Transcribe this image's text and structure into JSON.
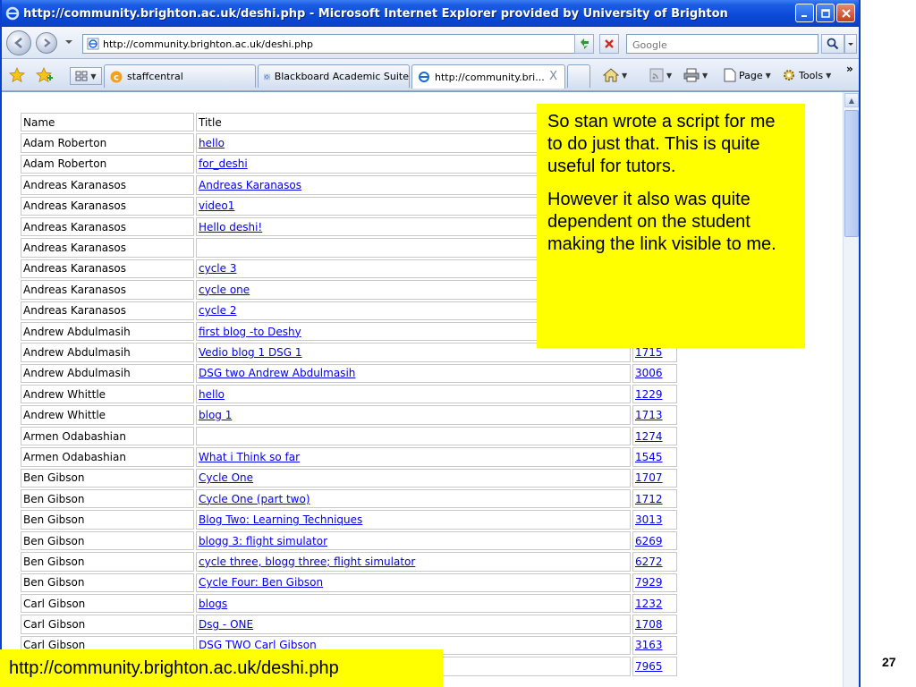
{
  "window": {
    "title": "http://community.brighton.ac.uk/deshi.php - Microsoft Internet Explorer provided by University of Brighton"
  },
  "address": {
    "url": "http://community.brighton.ac.uk/deshi.php",
    "search_placeholder": "Google"
  },
  "tabs": [
    {
      "label": "staffcentral"
    },
    {
      "label": "Blackboard Academic Suite"
    },
    {
      "label": "http://community.bri...",
      "close": "X"
    }
  ],
  "commands": {
    "page": "Page",
    "tools": "Tools",
    "more": "»"
  },
  "table": {
    "headers": {
      "name": "Name",
      "title": "Title"
    },
    "rows": [
      {
        "name": "Adam Roberton",
        "title": "hello",
        "id": ""
      },
      {
        "name": "Adam Roberton",
        "title": "for_deshi",
        "id": ""
      },
      {
        "name": "Andreas Karanasos",
        "title": "Andreas Karanasos",
        "id": ""
      },
      {
        "name": "Andreas Karanasos",
        "title": "video1",
        "id": ""
      },
      {
        "name": "Andreas Karanasos",
        "title": "Hello deshi!",
        "id": ""
      },
      {
        "name": "Andreas Karanasos",
        "title": "",
        "id": ""
      },
      {
        "name": "Andreas Karanasos",
        "title": "cycle 3",
        "id": ""
      },
      {
        "name": "Andreas Karanasos",
        "title": "cycle one",
        "id": ""
      },
      {
        "name": "Andreas Karanasos",
        "title": "cycle 2",
        "id": ""
      },
      {
        "name": "Andrew Abdulmasih",
        "title": "first blog -to Deshy",
        "id": ""
      },
      {
        "name": "Andrew Abdulmasih",
        "title": "Vedio blog 1 DSG 1",
        "id": "1715"
      },
      {
        "name": "Andrew Abdulmasih",
        "title": "DSG two Andrew Abdulmasih",
        "id": "3006"
      },
      {
        "name": "Andrew Whittle",
        "title": "hello",
        "id": "1229"
      },
      {
        "name": "Andrew Whittle",
        "title": "blog 1",
        "id": "1713"
      },
      {
        "name": "Armen Odabashian",
        "title": "",
        "id": "1274"
      },
      {
        "name": "Armen Odabashian",
        "title": "What i Think so far",
        "id": "1545"
      },
      {
        "name": "Ben Gibson",
        "title": "Cycle One",
        "id": "1707"
      },
      {
        "name": "Ben Gibson",
        "title": "Cycle One (part two)",
        "id": "1712"
      },
      {
        "name": "Ben Gibson",
        "title": "Blog Two: Learning Techniques",
        "id": "3013"
      },
      {
        "name": "Ben Gibson",
        "title": "blogg 3: flight simulator",
        "id": "6269"
      },
      {
        "name": "Ben Gibson",
        "title": "cycle three, blogg three; flight simulator",
        "id": "6272"
      },
      {
        "name": "Ben Gibson",
        "title": "Cycle Four: Ben Gibson",
        "id": "7929"
      },
      {
        "name": "Carl Gibson",
        "title": "blogs",
        "id": "1232"
      },
      {
        "name": "Carl Gibson",
        "title": "Dsg - ONE",
        "id": "1708"
      },
      {
        "name": "Carl Gibson",
        "title": "DSG TWO Carl Gibson",
        "id": "3163"
      },
      {
        "name": "",
        "title": "",
        "id": "7965"
      }
    ]
  },
  "note": {
    "paragraph1": "So stan wrote a script for me to do just that. This is quite useful for tutors.",
    "paragraph2": "However it also was quite dependent on the student making the link visible to me."
  },
  "caption": {
    "url": "http://community.brighton.ac.uk/deshi.php"
  },
  "slide": {
    "number": "27"
  },
  "colors": {
    "highlight": "#ffff00",
    "link": "#0000ee",
    "titlebar": "#0a49d8"
  }
}
